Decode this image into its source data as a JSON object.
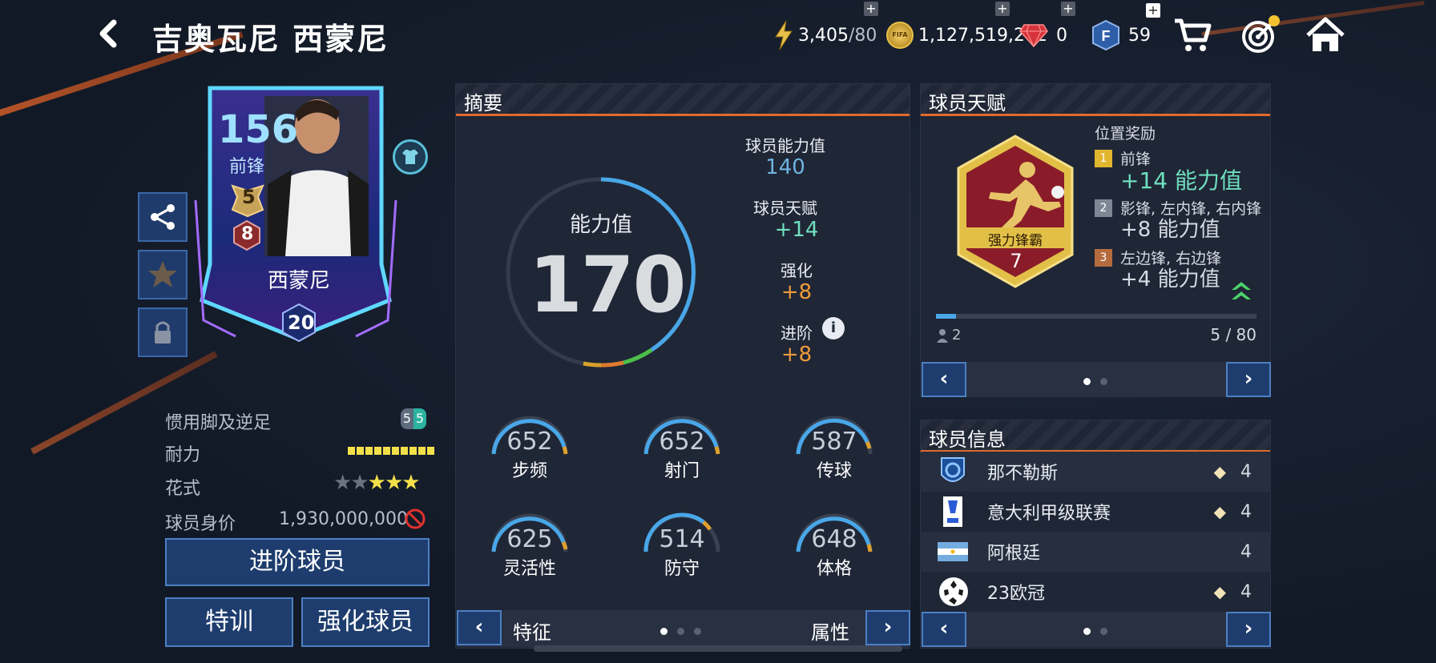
{
  "header": {
    "back_icon": "chevron-left-icon",
    "title": "吉奥瓦尼 西蒙尼"
  },
  "resources": {
    "energy": "3,405",
    "energy_max": "/80",
    "coins": "1,127,519,202",
    "coin_label": "FIFA",
    "gems": "0",
    "fifa_points": "59",
    "plus": "+"
  },
  "player_card": {
    "rating": "156",
    "position": "前锋",
    "rank": "5",
    "level": "8",
    "name": "西蒙尼",
    "season": "20"
  },
  "player_details": {
    "foot_label": "惯用脚及逆足",
    "foot_left": "5",
    "foot_right": "5",
    "stamina_label": "耐力",
    "skill_label": "花式",
    "value_label": "球员身价",
    "value": "1,930,000,000",
    "advance_btn": "进阶球员",
    "train_btn": "特训",
    "enhance_btn": "强化球员",
    "skill_stars": 3
  },
  "summary": {
    "header": "摘要",
    "ovr_label": "能力值",
    "ovr_value": "170",
    "base_label": "球员能力值",
    "base_value": "140",
    "talent_label": "球员天赋",
    "talent_value": "+14",
    "enhance_label": "强化",
    "enhance_value": "+8",
    "advance_label": "进阶",
    "advance_value": "+8",
    "stats": [
      {
        "value": "652",
        "label": "步频"
      },
      {
        "value": "652",
        "label": "射门"
      },
      {
        "value": "587",
        "label": "传球"
      },
      {
        "value": "625",
        "label": "灵活性"
      },
      {
        "value": "514",
        "label": "防守"
      },
      {
        "value": "648",
        "label": "体格"
      }
    ],
    "footer_left": "特征",
    "footer_right": "属性"
  },
  "talent": {
    "header": "球员天赋",
    "badge_name": "强力锋霸",
    "badge_level": "7",
    "bonus_title": "位置奖励",
    "tiers": [
      {
        "rank": "1",
        "positions": "前锋",
        "bonus": "+14 能力值"
      },
      {
        "rank": "2",
        "positions": "影锋, 左内锋, 右内锋",
        "bonus": "+8 能力值"
      },
      {
        "rank": "3",
        "positions": "左边锋, 右边锋",
        "bonus": "+4 能力值"
      }
    ],
    "count": "2",
    "progress_text": "5 / 80",
    "progress": 0.0625
  },
  "info": {
    "header": "球员信息",
    "rows": [
      {
        "name": "那不勒斯",
        "level": "4"
      },
      {
        "name": "意大利甲级联赛",
        "level": "4"
      },
      {
        "name": "阿根廷",
        "level": "4"
      },
      {
        "name": "23欧冠",
        "level": "4"
      }
    ]
  },
  "pager": {
    "prev": "‹",
    "next": "›"
  }
}
